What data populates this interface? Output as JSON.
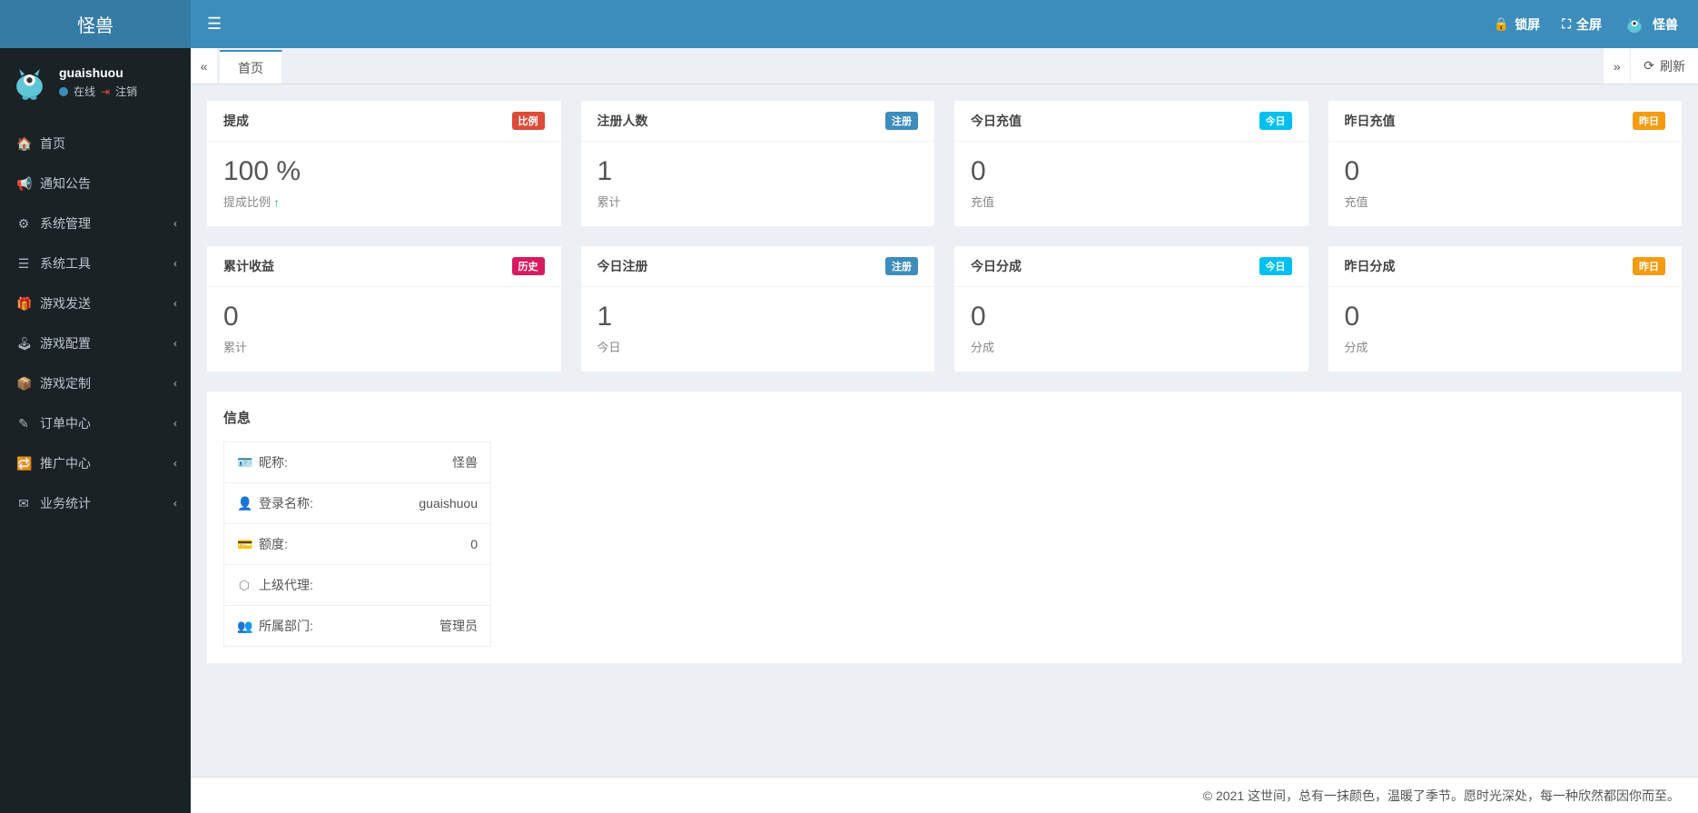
{
  "app_title": "怪兽",
  "header": {
    "lock": "锁屏",
    "fullscreen": "全屏",
    "user": "怪兽"
  },
  "user_panel": {
    "username": "guaishuou",
    "status": "在线",
    "logout": "注销"
  },
  "sidebar": {
    "items": [
      {
        "label": "首页",
        "icon": "🏠",
        "expand": false
      },
      {
        "label": "通知公告",
        "icon": "📢",
        "expand": false
      },
      {
        "label": "系统管理",
        "icon": "⚙",
        "expand": true
      },
      {
        "label": "系统工具",
        "icon": "☰",
        "expand": true
      },
      {
        "label": "游戏发送",
        "icon": "🎁",
        "expand": true
      },
      {
        "label": "游戏配置",
        "icon": "🕹",
        "expand": true
      },
      {
        "label": "游戏定制",
        "icon": "📦",
        "expand": true
      },
      {
        "label": "订单中心",
        "icon": "✎",
        "expand": true
      },
      {
        "label": "推广中心",
        "icon": "🔁",
        "expand": true
      },
      {
        "label": "业务统计",
        "icon": "✉",
        "expand": true
      }
    ]
  },
  "tabs": {
    "home": "首页",
    "refresh": "刷新"
  },
  "cards_row1": [
    {
      "title": "提成",
      "badge": "比例",
      "badgeClass": "badge-red",
      "value": "100 %",
      "sub": "提成比例",
      "arrow": true
    },
    {
      "title": "注册人数",
      "badge": "注册",
      "badgeClass": "badge-blue",
      "value": "1",
      "sub": "累计",
      "arrow": false
    },
    {
      "title": "今日充值",
      "badge": "今日",
      "badgeClass": "badge-cyan",
      "value": "0",
      "sub": "充值",
      "arrow": false
    },
    {
      "title": "昨日充值",
      "badge": "昨日",
      "badgeClass": "badge-orange",
      "value": "0",
      "sub": "充值",
      "arrow": false
    }
  ],
  "cards_row2": [
    {
      "title": "累计收益",
      "badge": "历史",
      "badgeClass": "badge-pink",
      "value": "0",
      "sub": "累计",
      "arrow": false
    },
    {
      "title": "今日注册",
      "badge": "注册",
      "badgeClass": "badge-blue",
      "value": "1",
      "sub": "今日",
      "arrow": false
    },
    {
      "title": "今日分成",
      "badge": "今日",
      "badgeClass": "badge-cyan",
      "value": "0",
      "sub": "分成",
      "arrow": false
    },
    {
      "title": "昨日分成",
      "badge": "昨日",
      "badgeClass": "badge-orange",
      "value": "0",
      "sub": "分成",
      "arrow": false
    }
  ],
  "info_panel": {
    "title": "信息",
    "rows": [
      {
        "icon": "🪪",
        "label": "昵称:",
        "value": "怪兽"
      },
      {
        "icon": "👤",
        "label": "登录名称:",
        "value": "guaishuou"
      },
      {
        "icon": "💳",
        "label": "额度:",
        "value": "0"
      },
      {
        "icon": "⬡",
        "label": "上级代理:",
        "value": ""
      },
      {
        "icon": "👥",
        "label": "所属部门:",
        "value": "管理员"
      }
    ]
  },
  "footer": "© 2021 这世间，总有一抹颜色，温暖了季节。愿时光深处，每一种欣然都因你而至。"
}
